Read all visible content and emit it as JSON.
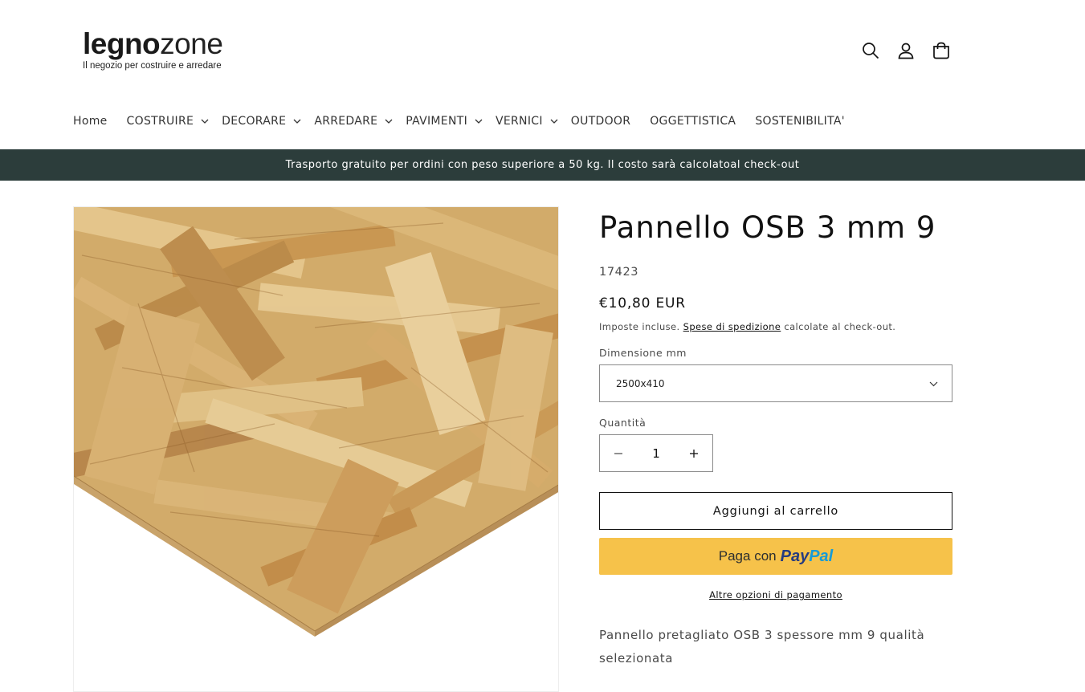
{
  "header": {
    "logo_bold": "legno",
    "logo_light": "zone",
    "logo_tagline": "Il negozio per costruire e arredare",
    "icons": [
      "search-icon",
      "account-icon",
      "cart-icon"
    ]
  },
  "nav": {
    "items": [
      {
        "label": "Home",
        "dropdown": false
      },
      {
        "label": "COSTRUIRE",
        "dropdown": true
      },
      {
        "label": "DECORARE",
        "dropdown": true
      },
      {
        "label": "ARREDARE",
        "dropdown": true
      },
      {
        "label": "PAVIMENTI",
        "dropdown": true
      },
      {
        "label": "VERNICI",
        "dropdown": true
      },
      {
        "label": "OUTDOOR",
        "dropdown": false
      },
      {
        "label": "OGGETTISTICA",
        "dropdown": false
      },
      {
        "label": "SOSTENIBILITA'",
        "dropdown": false
      }
    ]
  },
  "announcement": {
    "text": "Trasporto gratuito per ordini con peso superiore a 50 kg. Il costo sarà calcolatoal check-out",
    "background": "#2c3d3b"
  },
  "product": {
    "title": "Pannello OSB 3 mm 9",
    "sku": "17423",
    "price": "€10,80 EUR",
    "tax_prefix": "Imposte incluse.",
    "tax_link": "Spese di spedizione",
    "tax_suffix": "calcolate al check-out.",
    "size_label": "Dimensione mm",
    "size_value": "2500x410",
    "qty_label": "Quantità",
    "qty_value": "1",
    "add_to_cart": "Aggiungi al carrello",
    "paypal_prefix": "Paga con",
    "paypal_brand_1": "Pay",
    "paypal_brand_2": "Pal",
    "paypal_color": "#f6c24a",
    "more_payment": "Altre opzioni di pagamento",
    "description": "Pannello pretagliato OSB 3 spessore mm 9 qualità selezionata"
  }
}
